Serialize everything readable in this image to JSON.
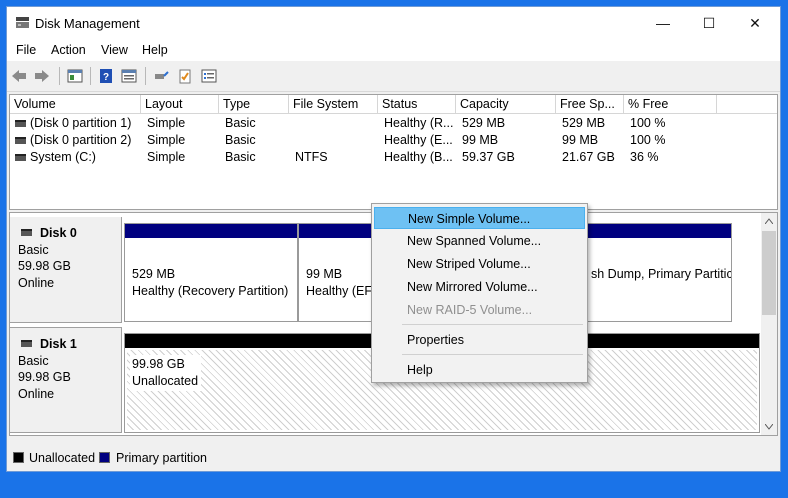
{
  "window": {
    "title": "Disk Management",
    "minimize_glyph": "—",
    "maximize_glyph": "☐",
    "close_glyph": "✕"
  },
  "menu": [
    "File",
    "Action",
    "View",
    "Help"
  ],
  "toolbar": {
    "icons": [
      "back-arrow-icon",
      "forward-arrow-icon",
      "console-tree-icon",
      "help-icon",
      "properties-pane-icon",
      "connect-icon",
      "checklist-icon",
      "list-view-icon"
    ]
  },
  "volume_list": {
    "columns": [
      "Volume",
      "Layout",
      "Type",
      "File System",
      "Status",
      "Capacity",
      "Free Sp...",
      "% Free"
    ],
    "rows": [
      [
        "(Disk 0 partition 1)",
        "Simple",
        "Basic",
        "",
        "Healthy (R...",
        "529 MB",
        "529 MB",
        "100 %"
      ],
      [
        "(Disk 0 partition 2)",
        "Simple",
        "Basic",
        "",
        "Healthy (E...",
        "99 MB",
        "99 MB",
        "100 %"
      ],
      [
        "System (C:)",
        "Simple",
        "Basic",
        "NTFS",
        "Healthy (B...",
        "59.37 GB",
        "21.67 GB",
        "36 %"
      ]
    ]
  },
  "disks": [
    {
      "name": "Disk 0",
      "type": "Basic",
      "size": "59.98 GB",
      "status": "Online",
      "partitions": [
        {
          "size": "529 MB",
          "status": "Healthy (Recovery Partition)"
        },
        {
          "size": "99 MB",
          "status": "Healthy (EFI"
        },
        {
          "size": "",
          "status": "sh Dump, Primary Partitic"
        }
      ]
    },
    {
      "name": "Disk 1",
      "type": "Basic",
      "size": "99.98 GB",
      "status": "Online",
      "unallocated": {
        "size": "99.98 GB",
        "label": "Unallocated"
      }
    }
  ],
  "legend": [
    {
      "label": "Unallocated",
      "color": "#000000"
    },
    {
      "label": "Primary partition",
      "color": "#000080"
    }
  ],
  "context_menu": {
    "items": [
      {
        "label": "New Simple Volume...",
        "state": "highlighted"
      },
      {
        "label": "New Spanned Volume...",
        "state": "enabled"
      },
      {
        "label": "New Striped Volume...",
        "state": "enabled"
      },
      {
        "label": "New Mirrored Volume...",
        "state": "enabled"
      },
      {
        "label": "New RAID-5 Volume...",
        "state": "disabled"
      },
      {
        "label": "Properties",
        "state": "enabled"
      },
      {
        "label": "Help",
        "state": "enabled"
      }
    ]
  },
  "colors": {
    "primary_partition": "#000080",
    "unallocated": "#000000",
    "menu_highlight": "#6ec1f3",
    "desktop": "#1a73e8"
  }
}
